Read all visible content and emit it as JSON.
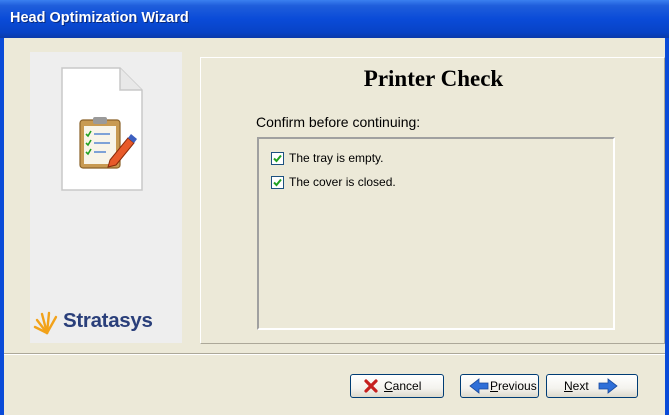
{
  "window": {
    "title": "Head Optimization Wizard"
  },
  "sidebar": {
    "brand": "Stratasys"
  },
  "main": {
    "title": "Printer Check",
    "prompt": "Confirm before continuing:",
    "checklist": [
      {
        "label": "The tray is empty.",
        "checked": true
      },
      {
        "label": "The cover is closed.",
        "checked": true
      }
    ]
  },
  "buttons": {
    "cancel": {
      "mnemonic": "C",
      "rest": "ancel"
    },
    "previous": {
      "mnemonic": "P",
      "rest": "revious"
    },
    "next": {
      "mnemonic": "N",
      "rest": "ext"
    }
  },
  "colors": {
    "title_bar": "#0a4bd8",
    "window_bg": "#ece9d8",
    "checkbox_tick": "#21a121",
    "arrow": "#2f6fd8",
    "cancel_x": "#c62020"
  }
}
